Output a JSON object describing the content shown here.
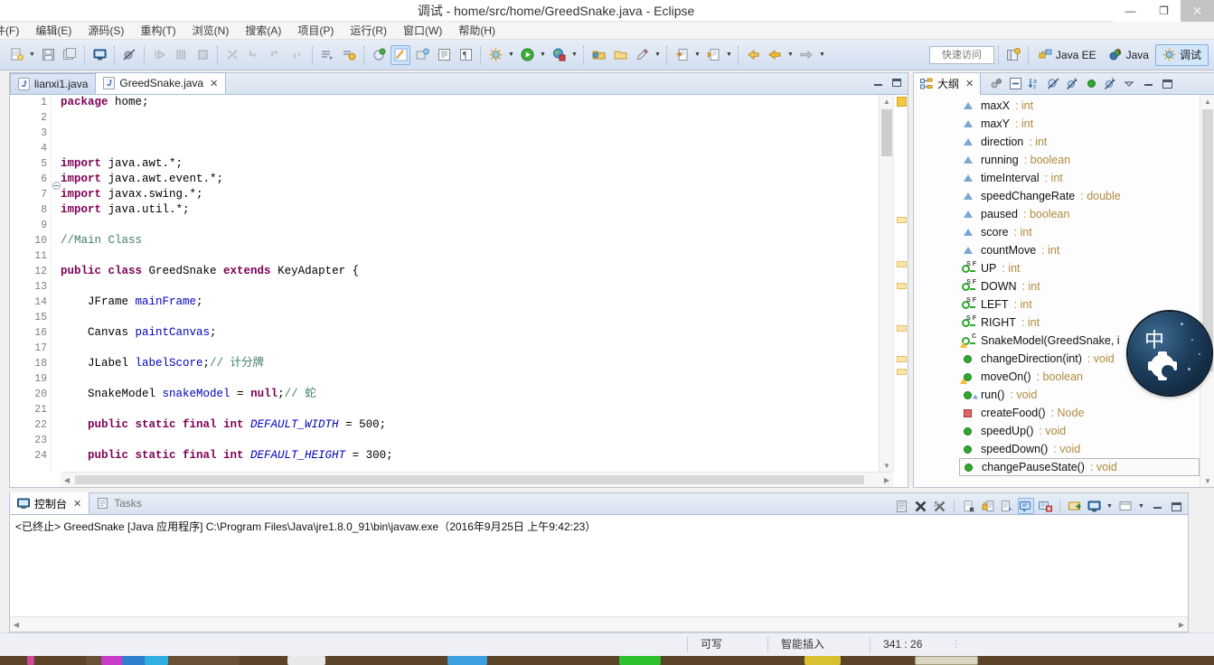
{
  "window": {
    "title": "调试 - home/src/home/GreedSnake.java - Eclipse",
    "minimize": "—",
    "maximize": "❐",
    "close": "✕"
  },
  "menubar": {
    "items": [
      {
        "label": "件(F)",
        "name": "menu-file"
      },
      {
        "label": "编辑(E)",
        "name": "menu-edit"
      },
      {
        "label": "源码(S)",
        "name": "menu-source"
      },
      {
        "label": "重构(T)",
        "name": "menu-refactor"
      },
      {
        "label": "浏览(N)",
        "name": "menu-navigate"
      },
      {
        "label": "搜索(A)",
        "name": "menu-search"
      },
      {
        "label": "项目(P)",
        "name": "menu-project"
      },
      {
        "label": "运行(R)",
        "name": "menu-run"
      },
      {
        "label": "窗口(W)",
        "name": "menu-window"
      },
      {
        "label": "帮助(H)",
        "name": "menu-help"
      }
    ]
  },
  "toolbar": {
    "quick_access_placeholder": "快速访问",
    "perspectives": [
      {
        "label": "Java EE",
        "active": false
      },
      {
        "label": "Java",
        "active": false
      },
      {
        "label": "调试",
        "active": true
      }
    ]
  },
  "editor": {
    "tabs": [
      {
        "label": "lianxi1.java",
        "active": false,
        "closable": false
      },
      {
        "label": "GreedSnake.java",
        "active": true,
        "closable": true
      }
    ],
    "lines": [
      {
        "n": "1",
        "fold": false,
        "tokens": [
          {
            "t": "package ",
            "c": "kw"
          },
          {
            "t": "home;",
            "c": "cn"
          }
        ]
      },
      {
        "n": "2",
        "fold": false,
        "tokens": []
      },
      {
        "n": "3",
        "fold": false,
        "tokens": []
      },
      {
        "n": "4",
        "fold": false,
        "tokens": []
      },
      {
        "n": "5",
        "fold": true,
        "tokens": [
          {
            "t": "import ",
            "c": "kw"
          },
          {
            "t": "java.awt.*;",
            "c": "cn"
          }
        ]
      },
      {
        "n": "6",
        "fold": false,
        "tokens": [
          {
            "t": "import ",
            "c": "kw"
          },
          {
            "t": "java.awt.event.*;",
            "c": "cn"
          }
        ]
      },
      {
        "n": "7",
        "fold": false,
        "tokens": [
          {
            "t": "import ",
            "c": "kw"
          },
          {
            "t": "javax.swing.*;",
            "c": "cn"
          }
        ]
      },
      {
        "n": "8",
        "fold": false,
        "tokens": [
          {
            "t": "import ",
            "c": "kw"
          },
          {
            "t": "java.util.*;",
            "c": "cn"
          }
        ]
      },
      {
        "n": "9",
        "fold": false,
        "tokens": []
      },
      {
        "n": "10",
        "fold": false,
        "tokens": [
          {
            "t": "//Main Class",
            "c": "cmt"
          }
        ]
      },
      {
        "n": "11",
        "fold": false,
        "tokens": []
      },
      {
        "n": "12",
        "fold": false,
        "tokens": [
          {
            "t": "public ",
            "c": "kw"
          },
          {
            "t": "class ",
            "c": "kw"
          },
          {
            "t": "GreedSnake ",
            "c": "cn"
          },
          {
            "t": "extends ",
            "c": "kw"
          },
          {
            "t": "KeyAdapter {",
            "c": "cn"
          }
        ]
      },
      {
        "n": "13",
        "fold": false,
        "tokens": []
      },
      {
        "n": "14",
        "fold": false,
        "tokens": [
          {
            "t": "    JFrame ",
            "c": "cn"
          },
          {
            "t": "mainFrame",
            "c": "fld"
          },
          {
            "t": ";",
            "c": "cn"
          }
        ]
      },
      {
        "n": "15",
        "fold": false,
        "tokens": []
      },
      {
        "n": "16",
        "fold": false,
        "tokens": [
          {
            "t": "    Canvas ",
            "c": "cn"
          },
          {
            "t": "paintCanvas",
            "c": "fld"
          },
          {
            "t": ";",
            "c": "cn"
          }
        ]
      },
      {
        "n": "17",
        "fold": false,
        "tokens": []
      },
      {
        "n": "18",
        "fold": false,
        "tokens": [
          {
            "t": "    JLabel ",
            "c": "cn"
          },
          {
            "t": "labelScore",
            "c": "fld"
          },
          {
            "t": ";",
            "c": "cn"
          },
          {
            "t": "// 计分牌",
            "c": "cmt"
          }
        ]
      },
      {
        "n": "19",
        "fold": false,
        "tokens": []
      },
      {
        "n": "20",
        "fold": false,
        "tokens": [
          {
            "t": "    SnakeModel ",
            "c": "cn"
          },
          {
            "t": "snakeModel",
            "c": "fld"
          },
          {
            "t": " = ",
            "c": "cn"
          },
          {
            "t": "null",
            "c": "kw"
          },
          {
            "t": ";",
            "c": "cn"
          },
          {
            "t": "// 蛇",
            "c": "cmt"
          }
        ]
      },
      {
        "n": "21",
        "fold": false,
        "tokens": []
      },
      {
        "n": "22",
        "fold": false,
        "tokens": [
          {
            "t": "    ",
            "c": "cn"
          },
          {
            "t": "public static final int ",
            "c": "kw"
          },
          {
            "t": "DEFAULT_WIDTH",
            "c": "sfld"
          },
          {
            "t": " = 500;",
            "c": "cn"
          }
        ]
      },
      {
        "n": "23",
        "fold": false,
        "tokens": []
      },
      {
        "n": "24",
        "fold": false,
        "tokens": [
          {
            "t": "    ",
            "c": "cn"
          },
          {
            "t": "public static final int ",
            "c": "kw"
          },
          {
            "t": "DEFAULT_HEIGHT",
            "c": "sfld"
          },
          {
            "t": " = 300;",
            "c": "cn"
          }
        ]
      }
    ]
  },
  "outline": {
    "tab_label": "大纲",
    "items": [
      {
        "icon": "field-icon",
        "name": "maxX",
        "type": " : int"
      },
      {
        "icon": "field-icon",
        "name": "maxY",
        "type": " : int"
      },
      {
        "icon": "field-icon",
        "name": "direction",
        "type": " : int"
      },
      {
        "icon": "field-icon",
        "name": "running",
        "type": " : boolean"
      },
      {
        "icon": "field-icon",
        "name": "timeInterval",
        "type": " : int"
      },
      {
        "icon": "field-icon",
        "name": "speedChangeRate",
        "type": " : double"
      },
      {
        "icon": "field-icon",
        "name": "paused",
        "type": " : boolean"
      },
      {
        "icon": "field-icon",
        "name": "score",
        "type": " : int"
      },
      {
        "icon": "field-icon",
        "name": "countMove",
        "type": " : int"
      },
      {
        "icon": "static-final-field-icon",
        "name": "UP",
        "type": " : int"
      },
      {
        "icon": "static-final-field-icon",
        "name": "DOWN",
        "type": " : int"
      },
      {
        "icon": "static-final-field-icon",
        "name": "LEFT",
        "type": " : int"
      },
      {
        "icon": "static-final-field-icon",
        "name": "RIGHT",
        "type": " : int"
      },
      {
        "icon": "constructor-icon",
        "name": "SnakeModel(GreedSnake, i",
        "type": ""
      },
      {
        "icon": "method-icon",
        "name": "changeDirection(int)",
        "type": " : void"
      },
      {
        "icon": "method-warning-icon",
        "name": "moveOn()",
        "type": " : boolean"
      },
      {
        "icon": "method-override-icon",
        "name": "run()",
        "type": " : void"
      },
      {
        "icon": "private-method-icon",
        "name": "createFood()",
        "type": " : Node"
      },
      {
        "icon": "method-icon",
        "name": "speedUp()",
        "type": " : void"
      },
      {
        "icon": "method-icon",
        "name": "speedDown()",
        "type": " : void"
      },
      {
        "icon": "method-icon",
        "name": "changePauseState()",
        "type": " : void",
        "selected": true
      }
    ]
  },
  "console": {
    "tabs": [
      {
        "label": "控制台",
        "active": true,
        "closable": true
      },
      {
        "label": "Tasks",
        "active": false,
        "closable": false
      }
    ],
    "output": "<已终止> GreedSnake [Java 应用程序] C:\\Program Files\\Java\\jre1.8.0_91\\bin\\javaw.exe（2016年9月25日 上午9:42:23）"
  },
  "statusbar": {
    "writable": "可写",
    "insert_mode": "智能插入",
    "cursor_position": "341 : 26"
  },
  "colors": {
    "keyword": "#7f0055",
    "field": "#0000c0",
    "comment": "#3f7f5f",
    "outline_type": "#b08b3e",
    "accent": "#cfe3f7"
  }
}
